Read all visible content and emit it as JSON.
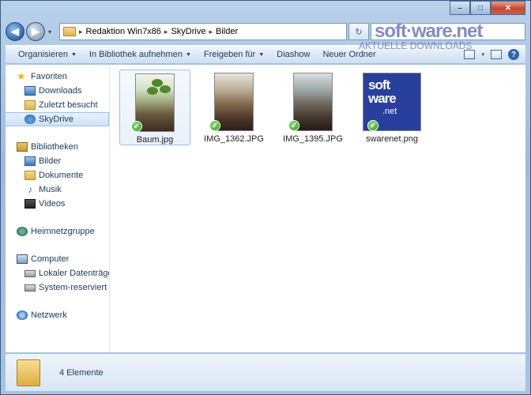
{
  "window": {
    "caption": {
      "minimize": "–",
      "maximize": "□",
      "close": "✕"
    }
  },
  "nav": {
    "back_glyph": "◀",
    "forward_glyph": "▶",
    "dropdown_glyph": "▾",
    "breadcrumb": [
      "Redaktion Win7x86",
      "SkyDrive",
      "Bilder"
    ],
    "refresh_glyph": "↻"
  },
  "watermark": {
    "logo": "soft·ware.net",
    "tagline": "AKTUELLE DOWNLOADS"
  },
  "toolbar": {
    "items": [
      {
        "label": "Organisieren",
        "caret": "▼"
      },
      {
        "label": "In Bibliothek aufnehmen",
        "caret": "▼"
      },
      {
        "label": "Freigeben für",
        "caret": "▼"
      },
      {
        "label": "Diashow",
        "caret": ""
      },
      {
        "label": "Neuer Ordner",
        "caret": ""
      }
    ],
    "view_caret": "▾",
    "help": "?"
  },
  "sidebar": {
    "favorites": {
      "label": "Favoriten",
      "items": [
        "Downloads",
        "Zuletzt besucht",
        "SkyDrive"
      ]
    },
    "libraries": {
      "label": "Bibliotheken",
      "items": [
        "Bilder",
        "Dokumente",
        "Musik",
        "Videos"
      ]
    },
    "homegroup": {
      "label": "Heimnetzgruppe"
    },
    "computer": {
      "label": "Computer",
      "items": [
        "Lokaler Datenträger",
        "System-reserviert (E:"
      ]
    },
    "network": {
      "label": "Netzwerk"
    }
  },
  "files": [
    {
      "name": "Baum.jpg",
      "status": "✓"
    },
    {
      "name": "IMG_1362.JPG",
      "status": "✓"
    },
    {
      "name": "IMG_1395.JPG",
      "status": "✓"
    },
    {
      "name": "swarenet.png",
      "status": "✓",
      "logo": [
        "soft",
        "ware",
        ".net"
      ]
    }
  ],
  "status": {
    "count": "4 Elemente"
  }
}
